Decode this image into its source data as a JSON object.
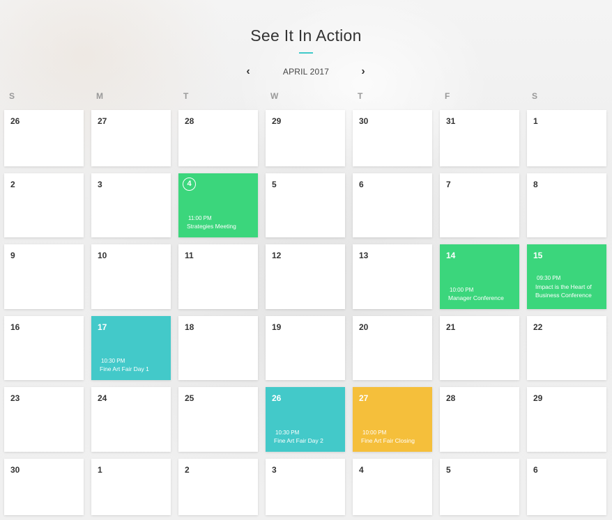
{
  "header": {
    "title": "See It In Action"
  },
  "nav": {
    "month_label": "APRIL 2017",
    "prev_symbol": "‹",
    "next_symbol": "›"
  },
  "weekdays": [
    "S",
    "M",
    "T",
    "W",
    "T",
    "F",
    "S"
  ],
  "weeks": [
    [
      {
        "day": "26"
      },
      {
        "day": "27"
      },
      {
        "day": "28"
      },
      {
        "day": "29"
      },
      {
        "day": "30"
      },
      {
        "day": "31"
      },
      {
        "day": "1"
      }
    ],
    [
      {
        "day": "2"
      },
      {
        "day": "3"
      },
      {
        "day": "4",
        "color": "green",
        "today": true,
        "time": "11:00 PM",
        "title": "Strategies Meeting"
      },
      {
        "day": "5"
      },
      {
        "day": "6"
      },
      {
        "day": "7"
      },
      {
        "day": "8"
      }
    ],
    [
      {
        "day": "9"
      },
      {
        "day": "10"
      },
      {
        "day": "11"
      },
      {
        "day": "12"
      },
      {
        "day": "13"
      },
      {
        "day": "14",
        "color": "green",
        "time": "10:00 PM",
        "title": "Manager Conference"
      },
      {
        "day": "15",
        "color": "green",
        "time": "09:30 PM",
        "title": "Impact is the Heart of Business Conference"
      }
    ],
    [
      {
        "day": "16"
      },
      {
        "day": "17",
        "color": "teal",
        "time": "10:30 PM",
        "title": "Fine Art Fair Day 1"
      },
      {
        "day": "18"
      },
      {
        "day": "19"
      },
      {
        "day": "20"
      },
      {
        "day": "21"
      },
      {
        "day": "22"
      }
    ],
    [
      {
        "day": "23"
      },
      {
        "day": "24"
      },
      {
        "day": "25"
      },
      {
        "day": "26",
        "color": "teal",
        "time": "10:30 PM",
        "title": "Fine Art Fair Day 2"
      },
      {
        "day": "27",
        "color": "yellow",
        "time": "10:00 PM",
        "title": "Fine Art Fair Closing"
      },
      {
        "day": "28"
      },
      {
        "day": "29"
      }
    ],
    [
      {
        "day": "30"
      },
      {
        "day": "1"
      },
      {
        "day": "2"
      },
      {
        "day": "3"
      },
      {
        "day": "4"
      },
      {
        "day": "5"
      },
      {
        "day": "6"
      }
    ]
  ],
  "colors": {
    "green": "#3bd67c",
    "teal": "#43c9c9",
    "yellow": "#f5bf3b",
    "accent": "#3fc9c9"
  }
}
